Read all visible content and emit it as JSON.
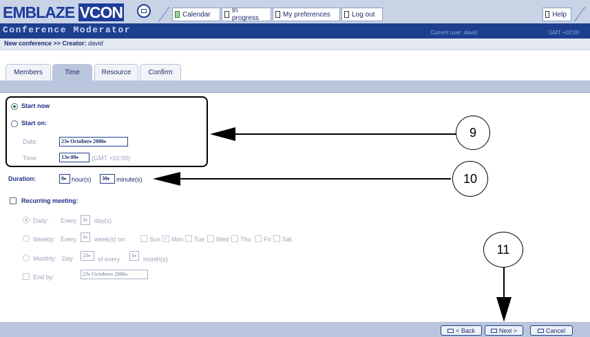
{
  "header": {
    "logo_left": "EMBLAZE",
    "logo_right": "VCON",
    "nav": [
      {
        "label": "Calendar",
        "icon": "calendar-icon"
      },
      {
        "label": "In progress",
        "icon": "in-progress-icon"
      },
      {
        "label": "My preferences",
        "icon": "preferences-icon"
      },
      {
        "label": "Log out",
        "icon": "logout-icon"
      }
    ],
    "help": "Help",
    "subtitle": "Conference Moderator",
    "current_user": "Current user: david",
    "gmt": "GMT +02:00"
  },
  "breadcrumb": {
    "prefix": "New conference >> Creator: ",
    "creator": "david"
  },
  "tabs": [
    "Members",
    "Time",
    "Resource",
    "Confirm"
  ],
  "selected_tab": "Time",
  "form": {
    "start_now": "Start now",
    "start_on": "Start on:",
    "date_label": "Date:",
    "date_day": "23",
    "date_month": "October",
    "date_year": "2006",
    "time_label": "Time:",
    "time_hour": "13",
    "time_min": "00",
    "time_tz": "(GMT +02:00)",
    "duration_label": "Duration:",
    "duration_hours": "0",
    "hours_unit": "hour(s)",
    "duration_minutes": "30",
    "minutes_unit": "minute(s)",
    "recurring": "Recurring meeting:",
    "daily": "Daily:",
    "every": "Every",
    "daily_val": "1",
    "days_unit": "day(s)",
    "weekly": "Weekly:",
    "weekly_val": "1",
    "weeks_on": "week(s) on:",
    "weekdays": [
      "Sun",
      "Mon",
      "Tue",
      "Wed",
      "Thu",
      "Fri",
      "Sat"
    ],
    "weekday_checked": "Mon",
    "monthly": "Monthly:",
    "day_word": "Day",
    "monthly_day": "23",
    "of_every": "of every",
    "monthly_val": "1",
    "months_unit": "month(s)",
    "end_by": "End by:",
    "end_day": "23",
    "end_month": "October",
    "end_year": "2006"
  },
  "annotations": {
    "c9": "9",
    "c10": "10",
    "c11": "11"
  },
  "footer": {
    "back": "< Back",
    "next": "Next >",
    "cancel": "Cancel"
  }
}
